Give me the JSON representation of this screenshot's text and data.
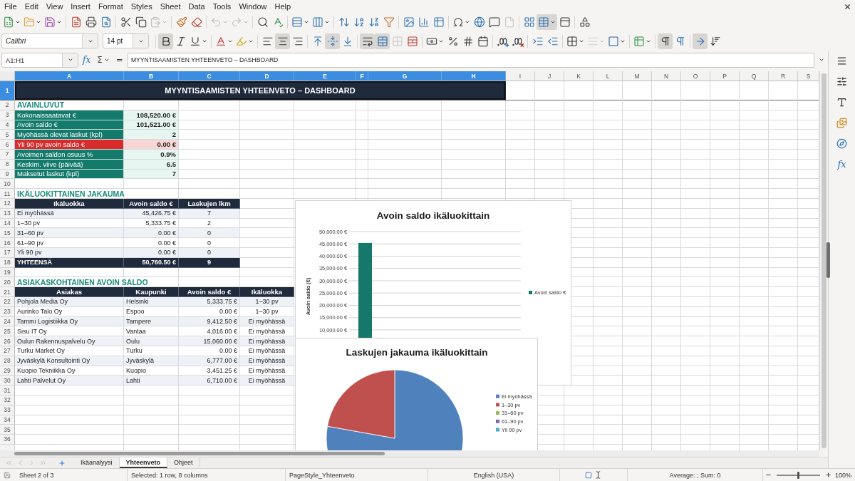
{
  "menu_bar": {
    "items": [
      "File",
      "Edit",
      "View",
      "Insert",
      "Format",
      "Styles",
      "Sheet",
      "Data",
      "Tools",
      "Window",
      "Help"
    ]
  },
  "standard_toolbar": {
    "buttons": [
      {
        "pressed": false,
        "disabled": false
      },
      {
        "pressed": false,
        "disabled": false
      },
      {
        "pressed": false,
        "disabled": false
      },
      {
        "pressed": false,
        "disabled": false
      },
      {
        "pressed": false,
        "disabled": false
      },
      {
        "pressed": false,
        "disabled": false
      },
      {
        "pressed": false,
        "disabled": false
      },
      {
        "pressed": false,
        "disabled": false
      },
      {
        "pressed": false,
        "disabled": true
      },
      {
        "pressed": false,
        "disabled": false
      },
      {
        "pressed": false,
        "disabled": false
      },
      {
        "pressed": false,
        "disabled": true
      },
      {
        "pressed": false,
        "disabled": true
      },
      {
        "pressed": false,
        "disabled": false
      },
      {
        "pressed": false,
        "disabled": false
      },
      {
        "pressed": false,
        "disabled": false
      },
      {
        "pressed": false,
        "disabled": false
      },
      {
        "pressed": false,
        "disabled": false
      },
      {
        "pressed": false,
        "disabled": false
      },
      {
        "pressed": false,
        "disabled": false
      },
      {
        "pressed": false,
        "disabled": false
      },
      {
        "pressed": false,
        "disabled": false
      },
      {
        "pressed": false,
        "disabled": false
      },
      {
        "pressed": false,
        "disabled": false
      },
      {
        "pressed": false,
        "disabled": false
      },
      {
        "pressed": false,
        "disabled": false
      },
      {
        "pressed": false,
        "disabled": false
      },
      {
        "pressed": false,
        "disabled": true
      },
      {
        "pressed": false,
        "disabled": false
      },
      {
        "pressed": true,
        "disabled": false
      },
      {
        "pressed": false,
        "disabled": false
      },
      {
        "pressed": false,
        "disabled": false
      }
    ]
  },
  "formatting_toolbar": {
    "font_name": "Calibri",
    "font_size": "14 pt",
    "buttons": [
      {
        "pressed": true,
        "disabled": false
      },
      {
        "pressed": false,
        "disabled": false
      },
      {
        "pressed": false,
        "disabled": false
      },
      {
        "pressed": false,
        "disabled": false
      },
      {
        "pressed": false,
        "disabled": false
      },
      {
        "pressed": false,
        "disabled": false
      },
      {
        "pressed": true,
        "disabled": false
      },
      {
        "pressed": false,
        "disabled": false
      },
      {
        "pressed": false,
        "disabled": false
      },
      {
        "pressed": true,
        "disabled": false
      },
      {
        "pressed": false,
        "disabled": false
      },
      {
        "pressed": true,
        "disabled": false
      },
      {
        "pressed": true,
        "disabled": false
      },
      {
        "pressed": false,
        "disabled": true
      },
      {
        "pressed": false,
        "disabled": false
      },
      {
        "pressed": false,
        "disabled": false
      },
      {
        "pressed": false,
        "disabled": false
      },
      {
        "pressed": false,
        "disabled": false
      },
      {
        "pressed": false,
        "disabled": false
      },
      {
        "pressed": false,
        "disabled": false
      },
      {
        "pressed": false,
        "disabled": false
      },
      {
        "pressed": false,
        "disabled": false
      },
      {
        "pressed": false,
        "disabled": false
      },
      {
        "pressed": false,
        "disabled": false
      },
      {
        "pressed": false,
        "disabled": true
      },
      {
        "pressed": false,
        "disabled": false
      },
      {
        "pressed": false,
        "disabled": false
      },
      {
        "pressed": true,
        "disabled": false
      },
      {
        "pressed": false,
        "disabled": false
      },
      {
        "pressed": true,
        "disabled": false
      },
      {
        "pressed": false,
        "disabled": false
      }
    ]
  },
  "formula_bar": {
    "name_box": "A1:H1",
    "function_wizard": "fx",
    "sum": "Σ",
    "equals": "=",
    "formula": "MYYNTISAAMISTEN YHTEENVETO – DASHBOARD"
  },
  "sheet": {
    "columns": [
      {
        "label": "A",
        "selected": true
      },
      {
        "label": "B",
        "selected": true
      },
      {
        "label": "C",
        "selected": true
      },
      {
        "label": "D",
        "selected": true
      },
      {
        "label": "E",
        "selected": true
      },
      {
        "label": "F",
        "selected": true
      },
      {
        "label": "G",
        "selected": true
      },
      {
        "label": "H",
        "selected": true
      },
      {
        "label": "I",
        "selected": false
      },
      {
        "label": "J",
        "selected": false
      },
      {
        "label": "K",
        "selected": false
      },
      {
        "label": "L",
        "selected": false
      },
      {
        "label": "M",
        "selected": false
      },
      {
        "label": "N",
        "selected": false
      },
      {
        "label": "O",
        "selected": false
      },
      {
        "label": "P",
        "selected": false
      },
      {
        "label": "Q",
        "selected": false
      },
      {
        "label": "R",
        "selected": false
      },
      {
        "label": "S",
        "selected": false
      }
    ],
    "rows": [
      {
        "number": "1",
        "selected": true,
        "kind": "title",
        "cells": [
          "MYYNTISAAMISTEN YHTEENVETO – DASHBOARD"
        ]
      },
      {
        "number": "2",
        "selected": false,
        "kind": "heading",
        "cells": [
          "AVAINLUVUT"
        ]
      },
      {
        "number": "3",
        "selected": false,
        "kind": "kpi",
        "alert": false,
        "cells": [
          "Kokonaissaatavat €",
          "108,520.00 €"
        ]
      },
      {
        "number": "4",
        "selected": false,
        "kind": "kpi",
        "alert": false,
        "cells": [
          "Avoin saldo €",
          "101,521.00 €"
        ]
      },
      {
        "number": "5",
        "selected": false,
        "kind": "kpi",
        "alert": false,
        "cells": [
          "Myöhässä olevat laskut (kpl)",
          "2"
        ]
      },
      {
        "number": "6",
        "selected": false,
        "kind": "kpi",
        "alert": true,
        "cells": [
          "Yli 90 pv avoin saldo €",
          "0.00 €"
        ]
      },
      {
        "number": "7",
        "selected": false,
        "kind": "kpi",
        "alert": false,
        "cells": [
          "Avoimen saldon osuus %",
          "0.9%"
        ]
      },
      {
        "number": "8",
        "selected": false,
        "kind": "kpi",
        "alert": false,
        "cells": [
          "Keskim. viive (päivää)",
          "6.5"
        ]
      },
      {
        "number": "9",
        "selected": false,
        "kind": "kpi",
        "alert": false,
        "cells": [
          "Maksetut laskut (kpl)",
          "7"
        ]
      },
      {
        "number": "10",
        "selected": false,
        "kind": "blank"
      },
      {
        "number": "11",
        "selected": false,
        "kind": "heading",
        "cells": [
          "IKÄLUOKITTAINEN JAKAUMA"
        ]
      },
      {
        "number": "12",
        "selected": false,
        "kind": "header",
        "cells": [
          "Ikäluokka",
          "Avoin saldo €",
          "Laskujen lkm"
        ]
      },
      {
        "number": "13",
        "selected": false,
        "kind": "age",
        "cells": [
          "Ei myöhässä",
          "45,426.75 €",
          "7"
        ]
      },
      {
        "number": "14",
        "selected": false,
        "kind": "age",
        "cells": [
          "1–30 pv",
          "5,333.75 €",
          "2"
        ]
      },
      {
        "number": "15",
        "selected": false,
        "kind": "age",
        "cells": [
          "31–60 pv",
          "0.00 €",
          "0"
        ]
      },
      {
        "number": "16",
        "selected": false,
        "kind": "age",
        "cells": [
          "61–90 pv",
          "0.00 €",
          "0"
        ]
      },
      {
        "number": "17",
        "selected": false,
        "kind": "age",
        "cells": [
          "Yli 90 pv",
          "0.00 €",
          "0"
        ]
      },
      {
        "number": "18",
        "selected": false,
        "kind": "total",
        "cells": [
          "YHTEENSÄ",
          "50,760.50 €",
          "9"
        ]
      },
      {
        "number": "19",
        "selected": false,
        "kind": "blank"
      },
      {
        "number": "20",
        "selected": false,
        "kind": "heading",
        "cells": [
          "ASIAKASKOHTAINEN AVOIN SALDO"
        ]
      },
      {
        "number": "21",
        "selected": false,
        "kind": "header",
        "cells": [
          "Asiakas",
          "Kaupunki",
          "Avoin saldo €",
          "Ikäluokka"
        ]
      },
      {
        "number": "22",
        "selected": false,
        "kind": "customer",
        "cells": [
          "Pohjola Media Oy",
          "Helsinki",
          "5,333.75 €",
          "1–30 pv"
        ]
      },
      {
        "number": "23",
        "selected": false,
        "kind": "customer",
        "cells": [
          "Aurinko Talo Oy",
          "Espoo",
          "0.00 €",
          "1–30 pv"
        ]
      },
      {
        "number": "24",
        "selected": false,
        "kind": "customer",
        "cells": [
          "Tammi Logistiikka Oy",
          "Tampere",
          "9,412.50 €",
          "Ei myöhässä"
        ]
      },
      {
        "number": "25",
        "selected": false,
        "kind": "customer",
        "cells": [
          "Sisu IT Oy",
          "Vantaa",
          "4,016.00 €",
          "Ei myöhässä"
        ]
      },
      {
        "number": "26",
        "selected": false,
        "kind": "customer",
        "cells": [
          "Oulun Rakennuspalvelu Oy",
          "Oulu",
          "15,060.00 €",
          "Ei myöhässä"
        ]
      },
      {
        "number": "27",
        "selected": false,
        "kind": "customer",
        "cells": [
          "Turku Market Oy",
          "Turku",
          "0.00 €",
          "Ei myöhässä"
        ]
      },
      {
        "number": "28",
        "selected": false,
        "kind": "customer",
        "cells": [
          "Jyväskylä Konsultointi Oy",
          "Jyväskylä",
          "6,777.00 €",
          "Ei myöhässä"
        ]
      },
      {
        "number": "29",
        "selected": false,
        "kind": "customer",
        "cells": [
          "Kuopio Tekniikka Oy",
          "Kuopio",
          "3,451.25 €",
          "Ei myöhässä"
        ]
      },
      {
        "number": "30",
        "selected": false,
        "kind": "customer",
        "cells": [
          "Lahti Palvelut Oy",
          "Lahti",
          "6,710.00 €",
          "Ei myöhässä"
        ]
      },
      {
        "number": "31",
        "selected": false,
        "kind": "blank"
      },
      {
        "number": "32",
        "selected": false,
        "kind": "blank"
      },
      {
        "number": "33",
        "selected": false,
        "kind": "blank"
      },
      {
        "number": "34",
        "selected": false,
        "kind": "blank"
      },
      {
        "number": "35",
        "selected": false,
        "kind": "blank"
      },
      {
        "number": "36",
        "selected": false,
        "kind": "blank"
      }
    ]
  },
  "bar_chart": {
    "chart_data": {
      "type": "bar",
      "title": "Avoin saldo ikäluokittain",
      "ylabel": "Avoin saldo (€)",
      "ylim": [
        6800,
        50000
      ],
      "yticks": [
        {
          "value": 50000,
          "label": "50,000.00 €"
        },
        {
          "value": 45000,
          "label": "45,000.00 €"
        },
        {
          "value": 40000,
          "label": "40,000.00 €"
        },
        {
          "value": 35000,
          "label": "35,000.00 €"
        },
        {
          "value": 30000,
          "label": "30,000.00 €"
        },
        {
          "value": 25000,
          "label": "25,000.00 €"
        },
        {
          "value": 20000,
          "label": "20,000.00 €"
        },
        {
          "value": 15000,
          "label": "15,000.00 €"
        },
        {
          "value": 10000,
          "label": "10,000.00 €"
        }
      ],
      "grid": true,
      "legend": "right",
      "series": [
        {
          "name": "Avoin saldo €",
          "color": "#16786a",
          "values": [
            45400
          ]
        }
      ]
    }
  },
  "pie_chart": {
    "chart_data": {
      "type": "pie",
      "title": "Laskujen jakauma ikäluokittain",
      "categories": [
        "Ei myöhässä",
        "1–30 pv",
        "31–60 pv",
        "61–90 pv",
        "Yli 90 pv"
      ],
      "values": [
        77.8,
        22.2,
        0,
        0,
        0
      ],
      "colors": [
        "#4f81bd",
        "#c0504d",
        "#9bbb59",
        "#8064a2",
        "#4bacc6"
      ],
      "legend": "right"
    }
  },
  "sheet_tabs": [
    {
      "label": "Ikäanalyysi",
      "selected": false
    },
    {
      "label": "Yhteenveto",
      "selected": true
    },
    {
      "label": "Ohjeet",
      "selected": false
    }
  ],
  "sidebar": {
    "functions_label": "fx"
  },
  "status_bar": {
    "sheet": "Sheet 2 of 3",
    "selection": "Selected: 1 row, 8 columns",
    "page_style": "PageStyle_Yhteenveto",
    "language": "English (USA)",
    "summary": "Average: ; Sum: 0",
    "zoom": {
      "level": 0.5,
      "reading": "100%"
    }
  }
}
